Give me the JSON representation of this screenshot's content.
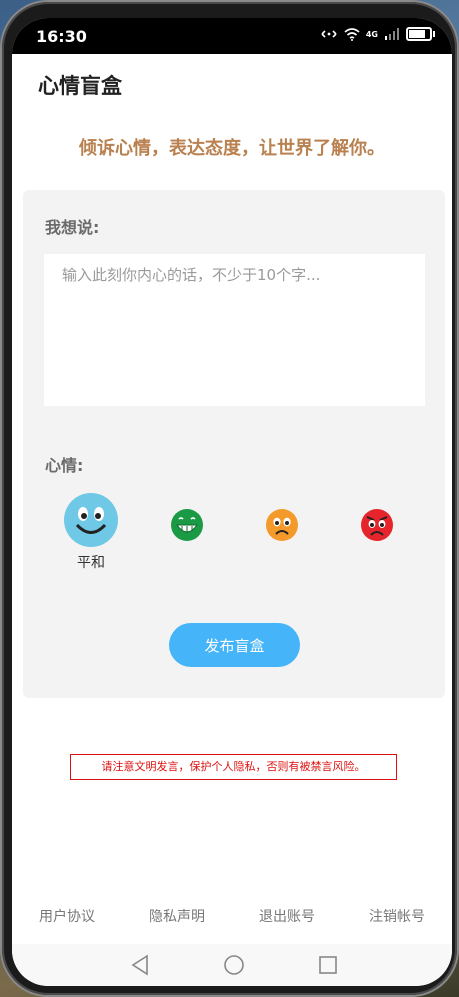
{
  "status_bar": {
    "time": "16:30",
    "network_label": "4G"
  },
  "header": {
    "title": "心情盲盒"
  },
  "slogan": "倾诉心情，表达态度，让世界了解你。",
  "form": {
    "say_label": "我想说:",
    "input_placeholder": "输入此刻你内心的话，不少于10个字...",
    "mood_label": "心情:",
    "moods": [
      {
        "name": "平和",
        "icon": "calm-face-icon",
        "color": "#6fc8e6",
        "selected": true
      },
      {
        "icon": "grin-face-icon",
        "color": "#1a9a44",
        "selected": false
      },
      {
        "icon": "worried-face-icon",
        "color": "#f39a2a",
        "selected": false
      },
      {
        "icon": "angry-face-icon",
        "color": "#e5242b",
        "selected": false
      }
    ],
    "publish_label": "发布盲盒"
  },
  "warning": "请注意文明发言，保护个人隐私，否则有被禁言风险。",
  "footer_links": [
    "用户协议",
    "隐私声明",
    "退出账号",
    "注销帐号"
  ],
  "colors": {
    "accent": "#45b4f8",
    "slogan": "#b9814f",
    "warning": "#dd1111"
  }
}
